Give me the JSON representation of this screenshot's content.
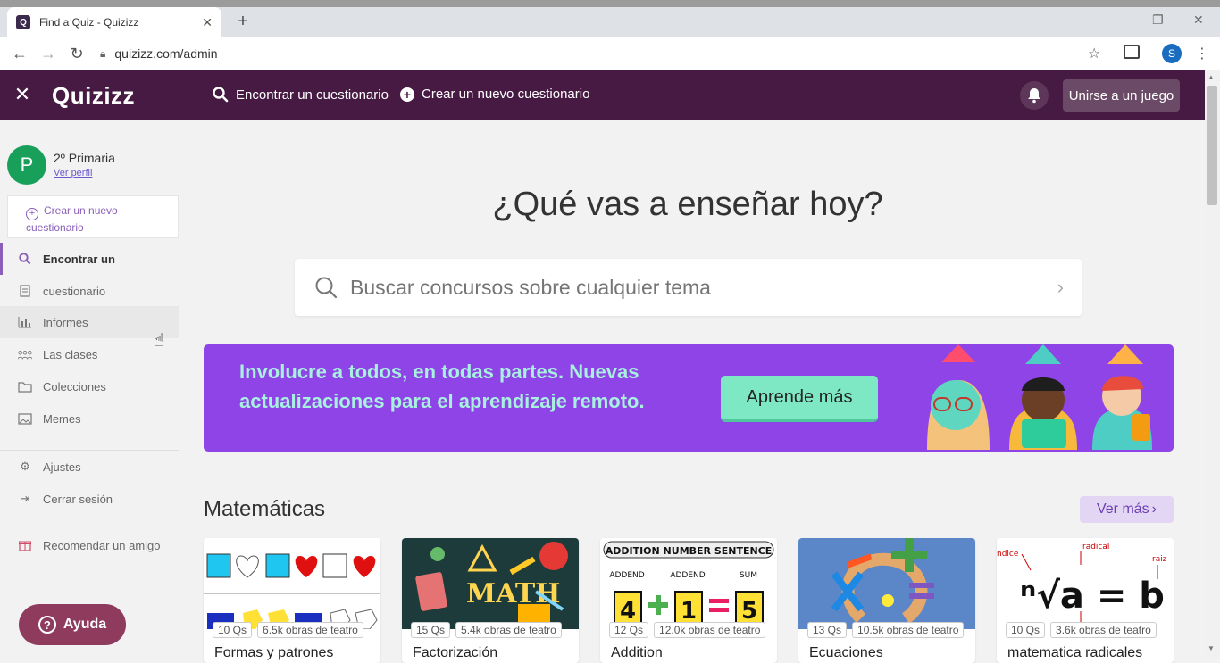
{
  "browser": {
    "tab_title": "Find a Quiz - Quizizz",
    "favicon_letter": "Q",
    "url": "quizizz.com/admin",
    "profile_letter": "S"
  },
  "header": {
    "logo": "Quizizz",
    "find_label": "Encontrar un cuestionario",
    "create_label": "Crear un nuevo cuestionario",
    "join_label": "Unirse a un juego"
  },
  "sidebar": {
    "user_initial": "P",
    "user_name": "2º Primaria",
    "profile_link": "Ver perfil",
    "create_line1": "Crear un nuevo",
    "create_line2": "cuestionario",
    "items": [
      {
        "label": "Encontrar un",
        "icon": "search-icon"
      },
      {
        "label": "cuestionario",
        "icon": "document-icon"
      },
      {
        "label": "Informes",
        "icon": "chart-icon"
      },
      {
        "label": "Las clases",
        "icon": "classes-icon"
      },
      {
        "label": "Colecciones",
        "icon": "folder-icon"
      },
      {
        "label": "Memes",
        "icon": "image-icon"
      },
      {
        "label": "Ajustes",
        "icon": "gear-icon"
      },
      {
        "label": "Cerrar sesión",
        "icon": "logout-icon"
      },
      {
        "label": "Recomendar un amigo",
        "icon": "gift-icon"
      }
    ]
  },
  "main": {
    "title": "¿Qué vas a enseñar hoy?",
    "search_placeholder": "Buscar concursos sobre cualquier tema",
    "banner_text": "Involucre a todos, en todas partes. Nuevas actualizaciones para el aprendizaje remoto.",
    "banner_button": "Aprende más",
    "section_title": "Matemáticas",
    "see_more": "Ver más",
    "cards": [
      {
        "qs": "10 Qs",
        "plays": "6.5k obras de teatro",
        "title": "Formas y patrones"
      },
      {
        "qs": "15 Qs",
        "plays": "5.4k obras de teatro",
        "title": "Factorización"
      },
      {
        "qs": "12 Qs",
        "plays": "12.0k obras de teatro",
        "title": "Addition"
      },
      {
        "qs": "13 Qs",
        "plays": "10.5k obras de teatro",
        "title": "Ecuaciones"
      },
      {
        "qs": "10 Qs",
        "plays": "3.6k obras de teatro",
        "title": "matematica radicales"
      }
    ],
    "thumb_texts": {
      "math_word": "MATH",
      "addition_header": "ADDITION NUMBER SENTENCE",
      "addend": "ADDEND",
      "sum": "SUM",
      "digit_a": "4",
      "digit_b": "1",
      "digit_c": "5",
      "radical_label": "radical",
      "indice_label": "ndice",
      "raiz_label": "raiz",
      "radical_expr": "ⁿ√a = b"
    }
  },
  "help_label": "Ayuda",
  "colors": {
    "header_bg": "#461a42",
    "banner_bg": "#8e44e6",
    "accent": "#8a5fb8",
    "banner_button": "#7ee8c4"
  }
}
